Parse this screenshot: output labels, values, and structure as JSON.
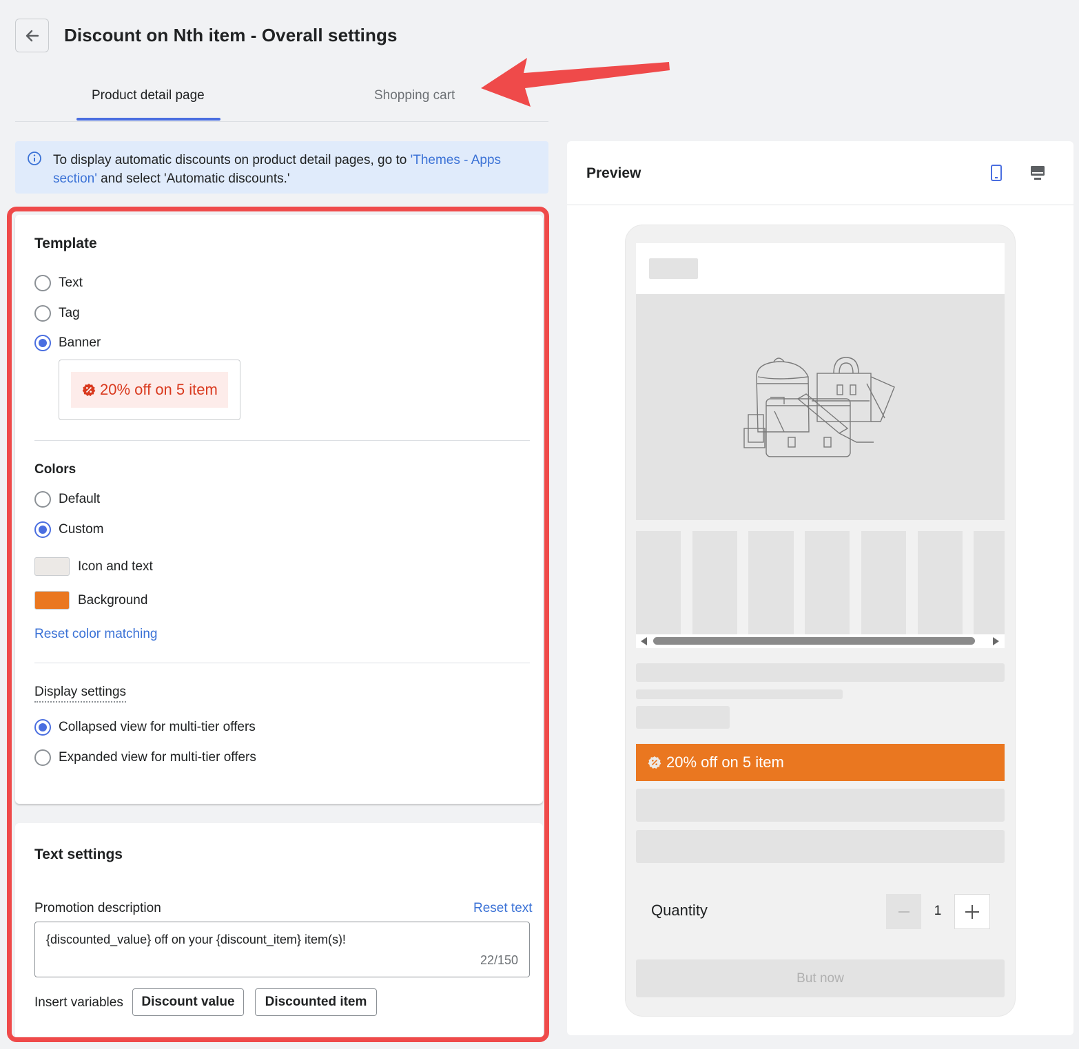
{
  "header": {
    "title": "Discount on Nth item - Overall settings",
    "back_icon": "arrow-left-icon"
  },
  "tabs": [
    {
      "label": "Product detail page",
      "active": true
    },
    {
      "label": "Shopping cart",
      "active": false
    }
  ],
  "info_banner": {
    "text_before": "To display automatic discounts on product detail pages, go to ",
    "link": "'Themes - Apps section'",
    "text_after": " and select 'Automatic discounts.'"
  },
  "template": {
    "heading": "Template",
    "options": [
      {
        "label": "Text",
        "selected": false
      },
      {
        "label": "Tag",
        "selected": false
      },
      {
        "label": "Banner",
        "selected": true
      }
    ],
    "banner_preview_text": "20% off on 5 item"
  },
  "colors": {
    "heading": "Colors",
    "options": [
      {
        "label": "Default",
        "selected": false
      },
      {
        "label": "Custom",
        "selected": true
      }
    ],
    "swatches": [
      {
        "label": "Icon and text",
        "color": "#ece9e6"
      },
      {
        "label": "Background",
        "color": "#ea7720"
      }
    ],
    "reset_link": "Reset color matching"
  },
  "display_settings": {
    "heading": "Display settings",
    "options": [
      {
        "label": "Collapsed view for multi-tier offers",
        "selected": true
      },
      {
        "label": "Expanded view for multi-tier offers",
        "selected": false
      }
    ]
  },
  "text_settings": {
    "heading": "Text settings",
    "promotion_label": "Promotion description",
    "reset_text": "Reset text",
    "promotion_value": "{discounted_value} off on your {discount_item} item(s)!",
    "counter": "22/150",
    "insert_label": "Insert variables",
    "variables": [
      "Discount value",
      "Discounted item"
    ]
  },
  "preview": {
    "title": "Preview",
    "promo_text": "20% off on 5 item",
    "quantity_label": "Quantity",
    "quantity_value": "1",
    "buy_label": "But now"
  },
  "colors_palette": {
    "accent": "#4a6ee0",
    "highlight_outline": "#ef4a4a",
    "promo_orange": "#ea7720"
  }
}
